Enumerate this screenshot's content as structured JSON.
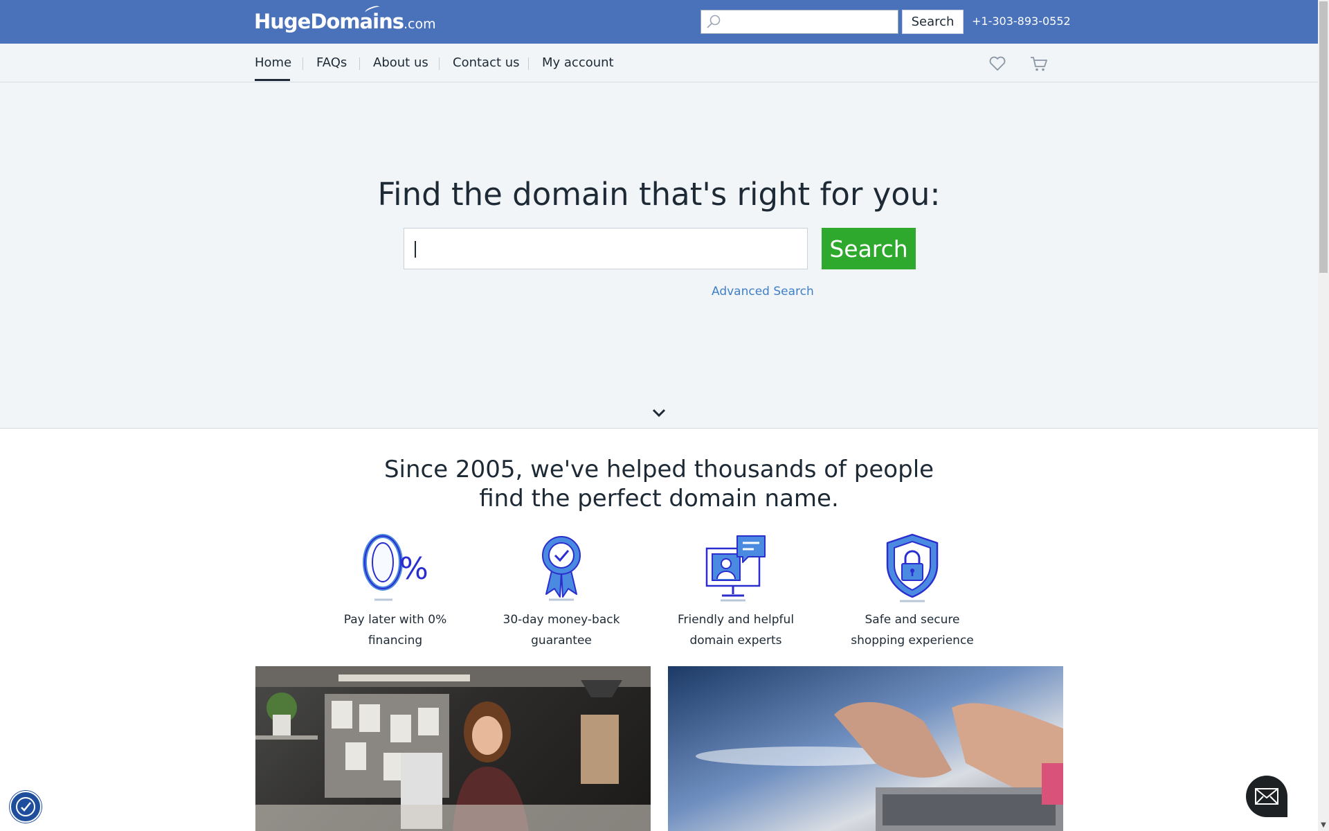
{
  "header": {
    "logo_main": "HugeDomains",
    "logo_suffix": ".com",
    "search_placeholder": "",
    "search_button": "Search",
    "phone": "+1-303-893-0552"
  },
  "nav": {
    "items": [
      {
        "label": "Home",
        "active": true
      },
      {
        "label": "FAQs"
      },
      {
        "label": "About us"
      },
      {
        "label": "Contact us"
      },
      {
        "label": "My account"
      }
    ],
    "icons": [
      "heart-icon",
      "cart-icon"
    ]
  },
  "hero": {
    "title": "Find the domain that's right for you:",
    "input_value": "",
    "search_button": "Search",
    "advanced_link": "Advanced Search"
  },
  "since": {
    "line1": "Since 2005, we've helped thousands of people",
    "line2": "find the perfect domain name."
  },
  "features": [
    {
      "icon": "zero-percent-icon",
      "line1": "Pay later with 0%",
      "line2": "financing"
    },
    {
      "icon": "award-ribbon-icon",
      "line1": "30-day money-back",
      "line2": "guarantee"
    },
    {
      "icon": "expert-monitor-icon",
      "line1": "Friendly and helpful",
      "line2": "domain experts"
    },
    {
      "icon": "shield-lock-icon",
      "line1": "Safe and secure",
      "line2": "shopping experience"
    }
  ],
  "colors": {
    "header_blue": "#4a72bb",
    "search_green": "#2ea92e",
    "link_blue": "#3f7fc8",
    "icon_blue": "#3b5bdb"
  }
}
